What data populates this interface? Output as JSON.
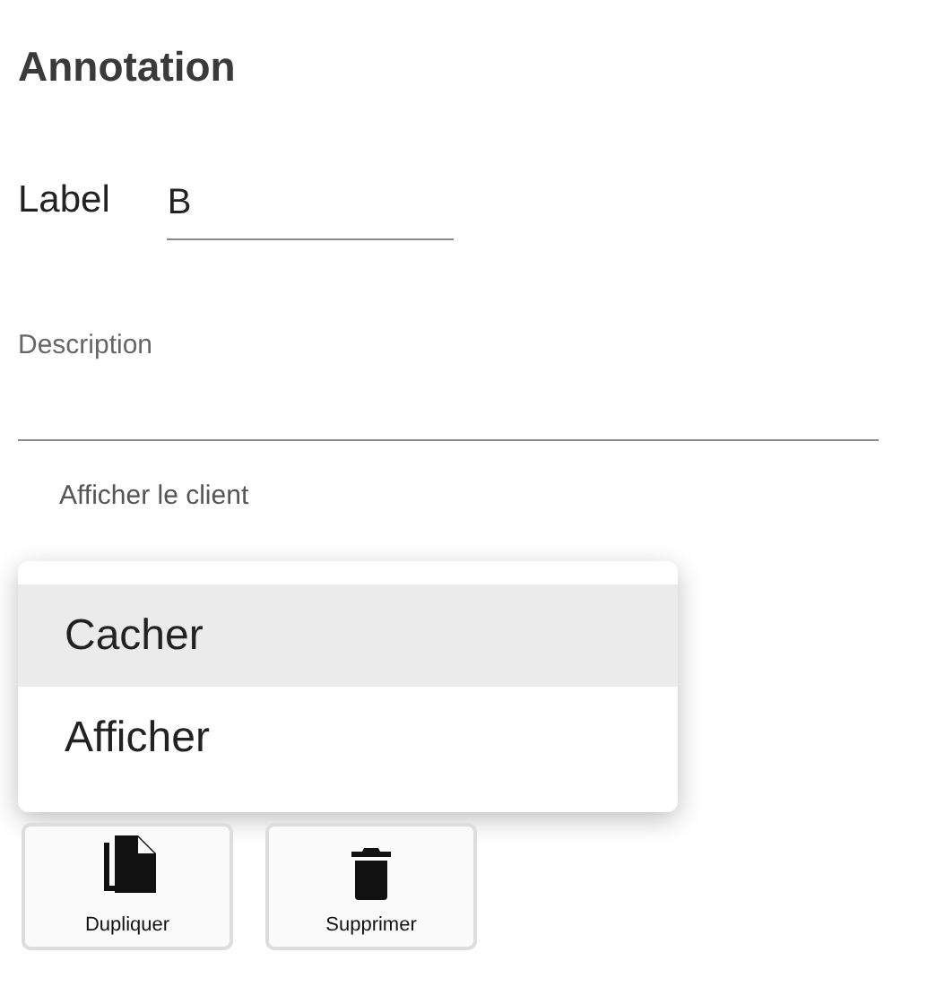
{
  "title": "Annotation",
  "label_field": {
    "label": "Label",
    "value": "B"
  },
  "description_field": {
    "label": "Description"
  },
  "client_select": {
    "label": "Afficher le client",
    "options": [
      {
        "label": "Cacher",
        "selected": true
      },
      {
        "label": "Afficher",
        "selected": false
      }
    ]
  },
  "buttons": [
    {
      "label": "Dupliquer",
      "kind": "duplicate"
    },
    {
      "label": "Supprimer",
      "kind": "delete"
    }
  ]
}
